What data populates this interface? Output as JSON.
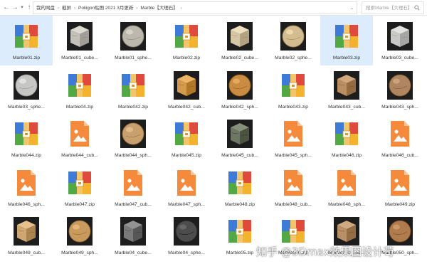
{
  "toolbar": {
    "back_icon": "arrow-left-icon",
    "forward_icon": "arrow-right-icon",
    "dropdown_icon": "chevron-down-icon",
    "up_icon": "arrow-up-icon"
  },
  "breadcrumb": [
    "我的网盘",
    "截屏",
    "Poliigon贴图 2021 3月更新",
    "Marble【大理石】"
  ],
  "search": {
    "placeholder": "搜索Marble【大理石】"
  },
  "watermark": "知乎 @3Dmax效果图设计苟",
  "colors": {
    "selected_bg": "#dcecfc",
    "archive_blue": "#3e7bd6",
    "archive_red": "#e04a3c",
    "archive_green": "#52a845",
    "archive_yellow": "#f3b32f",
    "image_file_orange": "#f58a3c"
  },
  "files": [
    {
      "name": "Marble01.zip",
      "type": "zip",
      "selected": true
    },
    {
      "name": "Marble01_cube...",
      "type": "cube",
      "color": "#c4c1ba"
    },
    {
      "name": "Marble01_sphe...",
      "type": "sphere",
      "color": "#bcb8ad"
    },
    {
      "name": "Marble02.zip",
      "type": "zip"
    },
    {
      "name": "Marble02_cube...",
      "type": "cube",
      "color": "#d5c6a5"
    },
    {
      "name": "Marble02_sphe...",
      "type": "sphere",
      "color": "#d3bc8f"
    },
    {
      "name": "Marble03.zip",
      "type": "zip",
      "selected": true
    },
    {
      "name": "Marble03_cube...",
      "type": "cube",
      "color": "#c9c9c7"
    },
    {
      "name": "Marble03_sphe...",
      "type": "sphere",
      "color": "#c6c6c4"
    },
    {
      "name": "Marble04.zip",
      "type": "zip"
    },
    {
      "name": "Marble042.zip",
      "type": "zip"
    },
    {
      "name": "Marble042_cub...",
      "type": "cube",
      "color": "#d49b4d"
    },
    {
      "name": "Marble042_sph...",
      "type": "sphere",
      "color": "#c98c42"
    },
    {
      "name": "Marble043.zip",
      "type": "zip"
    },
    {
      "name": "Marble043_cub...",
      "type": "cube",
      "color": "#b98e63"
    },
    {
      "name": "Marble043_sph...",
      "type": "sphere",
      "color": "#b08660"
    },
    {
      "name": "Marble044.zip",
      "type": "zip"
    },
    {
      "name": "Marble044_cub...",
      "type": "image"
    },
    {
      "name": "Marble044_sph...",
      "type": "sphere",
      "color": "#c8a06e"
    },
    {
      "name": "Marble045.zip",
      "type": "zip"
    },
    {
      "name": "Marble045_cub...",
      "type": "cube",
      "color": "#6e7763"
    },
    {
      "name": "Marble045_sph...",
      "type": "image"
    },
    {
      "name": "Marble046.zip",
      "type": "zip"
    },
    {
      "name": "Marble046_cub...",
      "type": "image"
    },
    {
      "name": "Marble046_sph...",
      "type": "image"
    },
    {
      "name": "Marble047.zip",
      "type": "zip"
    },
    {
      "name": "Marble047_cub...",
      "type": "image"
    },
    {
      "name": "Marble047_sph...",
      "type": "image"
    },
    {
      "name": "Marble048.zip",
      "type": "zip"
    },
    {
      "name": "Marble048_cub...",
      "type": "image"
    },
    {
      "name": "Marble048_sph...",
      "type": "image"
    },
    {
      "name": "Marble049.zip",
      "type": "image"
    },
    {
      "name": "Marble049_cub...",
      "type": "cube",
      "color": "#cfa772"
    },
    {
      "name": "Marble049_sph...",
      "type": "sphere",
      "color": "#c89a5e"
    },
    {
      "name": "Marble04_cube...",
      "type": "cube",
      "color": "#7a7a7a"
    },
    {
      "name": "Marble04_sphe...",
      "type": "sphere",
      "color": "#4c4c4c"
    },
    {
      "name": "Marble05.zip",
      "type": "zip"
    },
    {
      "name": "Marble050.zip",
      "type": "zip"
    },
    {
      "name": "Marble050_cub...",
      "type": "cube",
      "color": "#b79068"
    },
    {
      "name": "Marble050_sph...",
      "type": "sphere",
      "color": "#b07c4d"
    }
  ]
}
